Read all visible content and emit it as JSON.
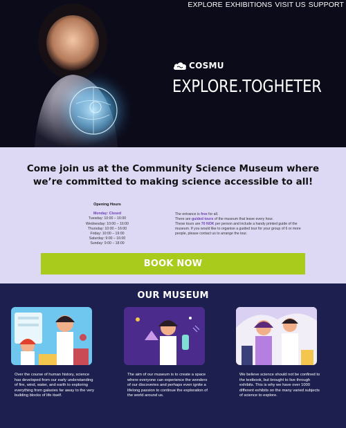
{
  "nav": {
    "items": [
      "EXPLORE",
      "EXHIBITIONS",
      "VISIT US",
      "SUPPORT"
    ]
  },
  "brand": {
    "name": "COSMU"
  },
  "hero": {
    "title": "EXPLORE.TOGHETER"
  },
  "info": {
    "headline": "Come join us at the Community Science Museum where we’re committed to making science accessible to all!",
    "hours_title": "Opening Hours",
    "hours": [
      "Monday: Closed",
      "Tuesday: 10:00 – 16:00",
      "Wednesday: 10:00 – 16:00",
      "Thursday: 10:00 – 16:00",
      "Friday: 10:00 – 19:00",
      "Saturday: 9:00 – 16:00",
      "Sunday: 9:00 – 18:00"
    ],
    "entrance": {
      "p1_pre": "The entrance is ",
      "p1_bold": "free",
      "p1_post": " for all.",
      "p2_pre": "There are ",
      "p2_bold": "guided tours",
      "p2_post": " of the museum that leave every hour.",
      "p3_pre": "These tours are ",
      "p3_bold": "70 NOK",
      "p3_post": " per person and include a handy printed guide of the museum. If you would like to organise a guided tour for your group of 6 or more people, please contact us to arrange the tour."
    },
    "book_label": "BOOK NOW"
  },
  "museum": {
    "title": "OUR MUSEUM",
    "cards": [
      {
        "text": "Over the course of human history, science has developed from our early understanding of fire, wind, water, and earth to exploring everything from galaxies far away to the very building blocks of life itself.",
        "bg": "#6fc6ef"
      },
      {
        "text": "The aim of our museum is to create a space where everyone can experience the wonders of our discoveries and perhaps even ignite a lifelong passion to continue the exploration of the world around us.",
        "bg": "#4b2b8c"
      },
      {
        "text": "We believe science should not be confined to the textbook, but brought to live through exhibits. This is why we have over 1000 different exhibits on the many varied subjects of science to explore.",
        "bg": "#f1eef8"
      }
    ]
  },
  "colors": {
    "hero_bg": "#0b0b1a",
    "info_bg": "#ddd9f5",
    "accent_green": "#a9cb1c",
    "accent_purple": "#6b3fb2",
    "museum_bg": "#1d1f4e"
  }
}
